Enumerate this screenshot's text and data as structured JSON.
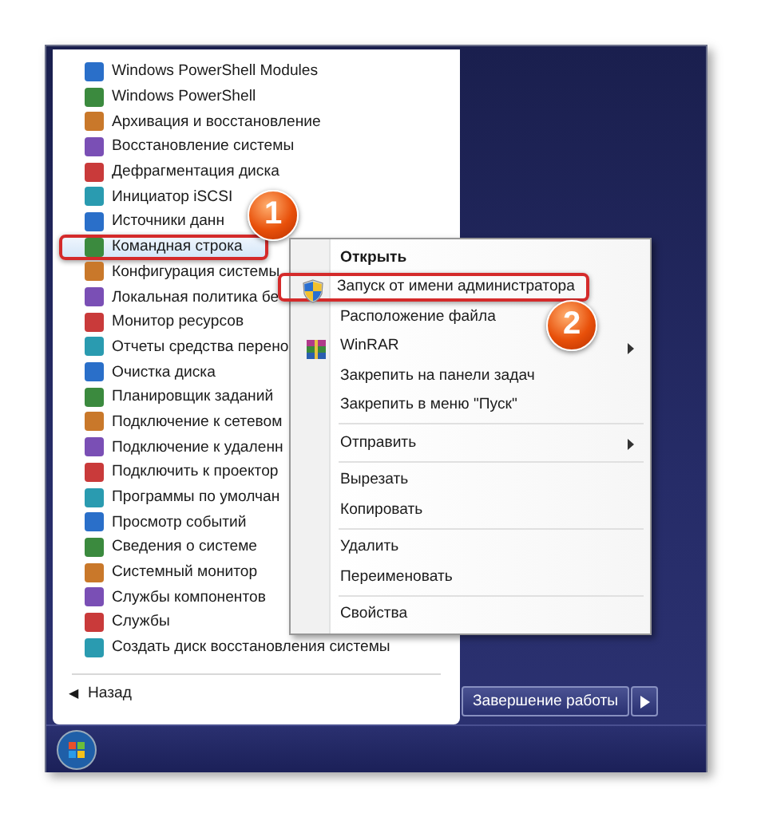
{
  "programs": [
    {
      "label": "Windows PowerShell Modules",
      "selected": false
    },
    {
      "label": "Windows PowerShell",
      "selected": false
    },
    {
      "label": "Архивация и восстановление",
      "selected": false
    },
    {
      "label": "Восстановление системы",
      "selected": false
    },
    {
      "label": "Дефрагментация диска",
      "selected": false
    },
    {
      "label": "Инициатор iSCSI",
      "selected": false
    },
    {
      "label": "Источники данн",
      "selected": false
    },
    {
      "label": "Командная строка",
      "selected": true
    },
    {
      "label": "Конфигурация системы",
      "selected": false
    },
    {
      "label": "Локальная политика бе",
      "selected": false
    },
    {
      "label": "Монитор ресурсов",
      "selected": false
    },
    {
      "label": "Отчеты средства перено",
      "selected": false
    },
    {
      "label": "Очистка диска",
      "selected": false
    },
    {
      "label": "Планировщик заданий",
      "selected": false
    },
    {
      "label": "Подключение к сетевом",
      "selected": false
    },
    {
      "label": "Подключение к удаленн",
      "selected": false
    },
    {
      "label": "Подключить к проектор",
      "selected": false
    },
    {
      "label": "Программы по умолчан",
      "selected": false
    },
    {
      "label": "Просмотр событий",
      "selected": false
    },
    {
      "label": "Сведения о системе",
      "selected": false
    },
    {
      "label": "Системный монитор",
      "selected": false
    },
    {
      "label": "Службы компонентов",
      "selected": false
    },
    {
      "label": "Службы",
      "selected": false
    },
    {
      "label": "Создать диск восстановления системы",
      "selected": false
    }
  ],
  "back": {
    "arrow": "◀",
    "label": "Назад"
  },
  "context_menu": [
    {
      "kind": "item",
      "label": "Открыть",
      "default": true,
      "submenu": false,
      "selected": false
    },
    {
      "kind": "item",
      "label": "Запуск от имени администратора",
      "default": false,
      "submenu": false,
      "selected": true
    },
    {
      "kind": "item",
      "label": "Расположение файла",
      "default": false,
      "submenu": false,
      "selected": false
    },
    {
      "kind": "item",
      "label": "WinRAR",
      "default": false,
      "submenu": true,
      "selected": false
    },
    {
      "kind": "item",
      "label": "Закрепить на панели задач",
      "default": false,
      "submenu": false,
      "selected": false
    },
    {
      "kind": "item",
      "label": "Закрепить в меню \"Пуск\"",
      "default": false,
      "submenu": false,
      "selected": false
    },
    {
      "kind": "separator"
    },
    {
      "kind": "item",
      "label": "Отправить",
      "default": false,
      "submenu": true,
      "selected": false
    },
    {
      "kind": "separator"
    },
    {
      "kind": "item",
      "label": "Вырезать",
      "default": false,
      "submenu": false,
      "selected": false
    },
    {
      "kind": "item",
      "label": "Копировать",
      "default": false,
      "submenu": false,
      "selected": false
    },
    {
      "kind": "separator"
    },
    {
      "kind": "item",
      "label": "Удалить",
      "default": false,
      "submenu": false,
      "selected": false
    },
    {
      "kind": "item",
      "label": "Переименовать",
      "default": false,
      "submenu": false,
      "selected": false
    },
    {
      "kind": "separator"
    },
    {
      "kind": "item",
      "label": "Свойства",
      "default": false,
      "submenu": false,
      "selected": false
    }
  ],
  "callouts": [
    "1",
    "2"
  ],
  "shutdown_button": {
    "label": "Завершение работы"
  }
}
